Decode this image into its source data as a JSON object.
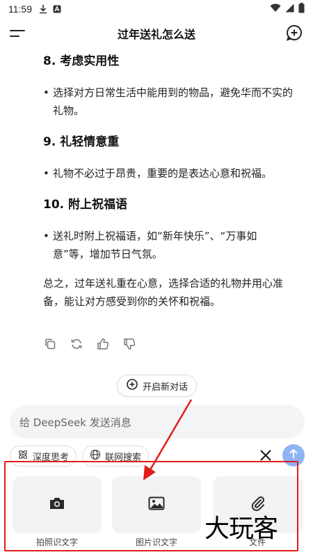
{
  "status_bar": {
    "time": "11:59"
  },
  "header": {
    "title": "过年送礼怎么送"
  },
  "content": {
    "sec8_title": "8. 考虑实用性",
    "sec8_text": "选择对方日常生活中能用到的物品，避免华而不实的礼物。",
    "sec9_title": "9. 礼轻情意重",
    "sec9_text": "礼物不必过于昂贵，重要的是表达心意和祝福。",
    "sec10_title": "10. 附上祝福语",
    "sec10_text": "送礼时附上祝福语，如“新年快乐”、“万事如意”等，增加节日气氛。",
    "summary": "总之，过年送礼重在心意，选择合适的礼物并用心准备，能让对方感受到你的关怀和祝福。"
  },
  "new_dialog_label": "开启新对话",
  "input": {
    "placeholder": "给 DeepSeek 发送消息"
  },
  "chips": {
    "deep_think": "深度思考",
    "web_search": "联网搜索"
  },
  "tools": {
    "photo_ocr": "拍照识文字",
    "image_ocr": "图片识文字",
    "file": "文件"
  },
  "watermark": "大玩客",
  "colors": {
    "annotation_red": "#e21b1b",
    "send_button": "#8fb4f5"
  }
}
